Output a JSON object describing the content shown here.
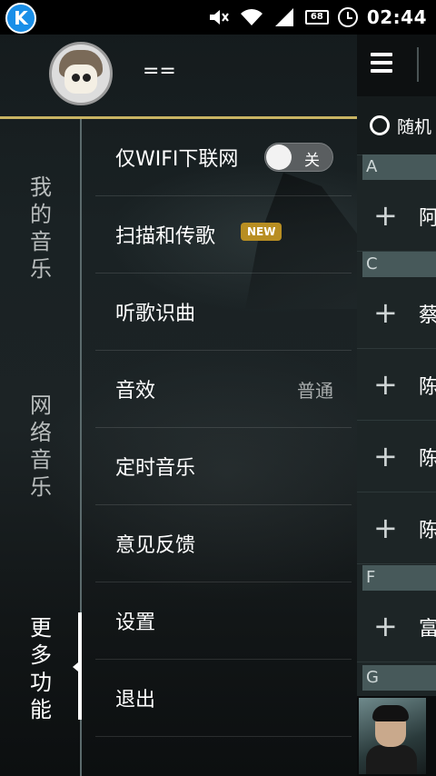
{
  "status_bar": {
    "app_icon_letter": "K",
    "battery_level": "68",
    "time": "02:44"
  },
  "profile": {
    "username": "=="
  },
  "side_tabs": [
    {
      "label": "我的音乐"
    },
    {
      "label": "网络音乐"
    },
    {
      "label": "更多功能",
      "active": true
    }
  ],
  "menu": {
    "wifi_only": {
      "label": "仅WIFI下联网",
      "toggle_text": "关",
      "toggle_on": false
    },
    "scan_transfer": {
      "label": "扫描和传歌",
      "badge": "NEW"
    },
    "song_recognition": {
      "label": "听歌识曲"
    },
    "sound_effect": {
      "label": "音效",
      "value": "普通"
    },
    "sleep_timer": {
      "label": "定时音乐"
    },
    "feedback": {
      "label": "意见反馈"
    },
    "settings": {
      "label": "设置"
    },
    "exit": {
      "label": "退出"
    }
  },
  "right_panel": {
    "random_label": "随机",
    "sections": [
      {
        "letter": "A",
        "rows": [
          "阿"
        ]
      },
      {
        "letter": "C",
        "rows": [
          "蔡",
          "陈",
          "陈",
          "陈"
        ]
      },
      {
        "letter": "F",
        "rows": [
          "富"
        ]
      },
      {
        "letter": "G",
        "rows": []
      }
    ]
  },
  "colors": {
    "accent_gold": "#c9b463",
    "badge": "#b88e22"
  }
}
